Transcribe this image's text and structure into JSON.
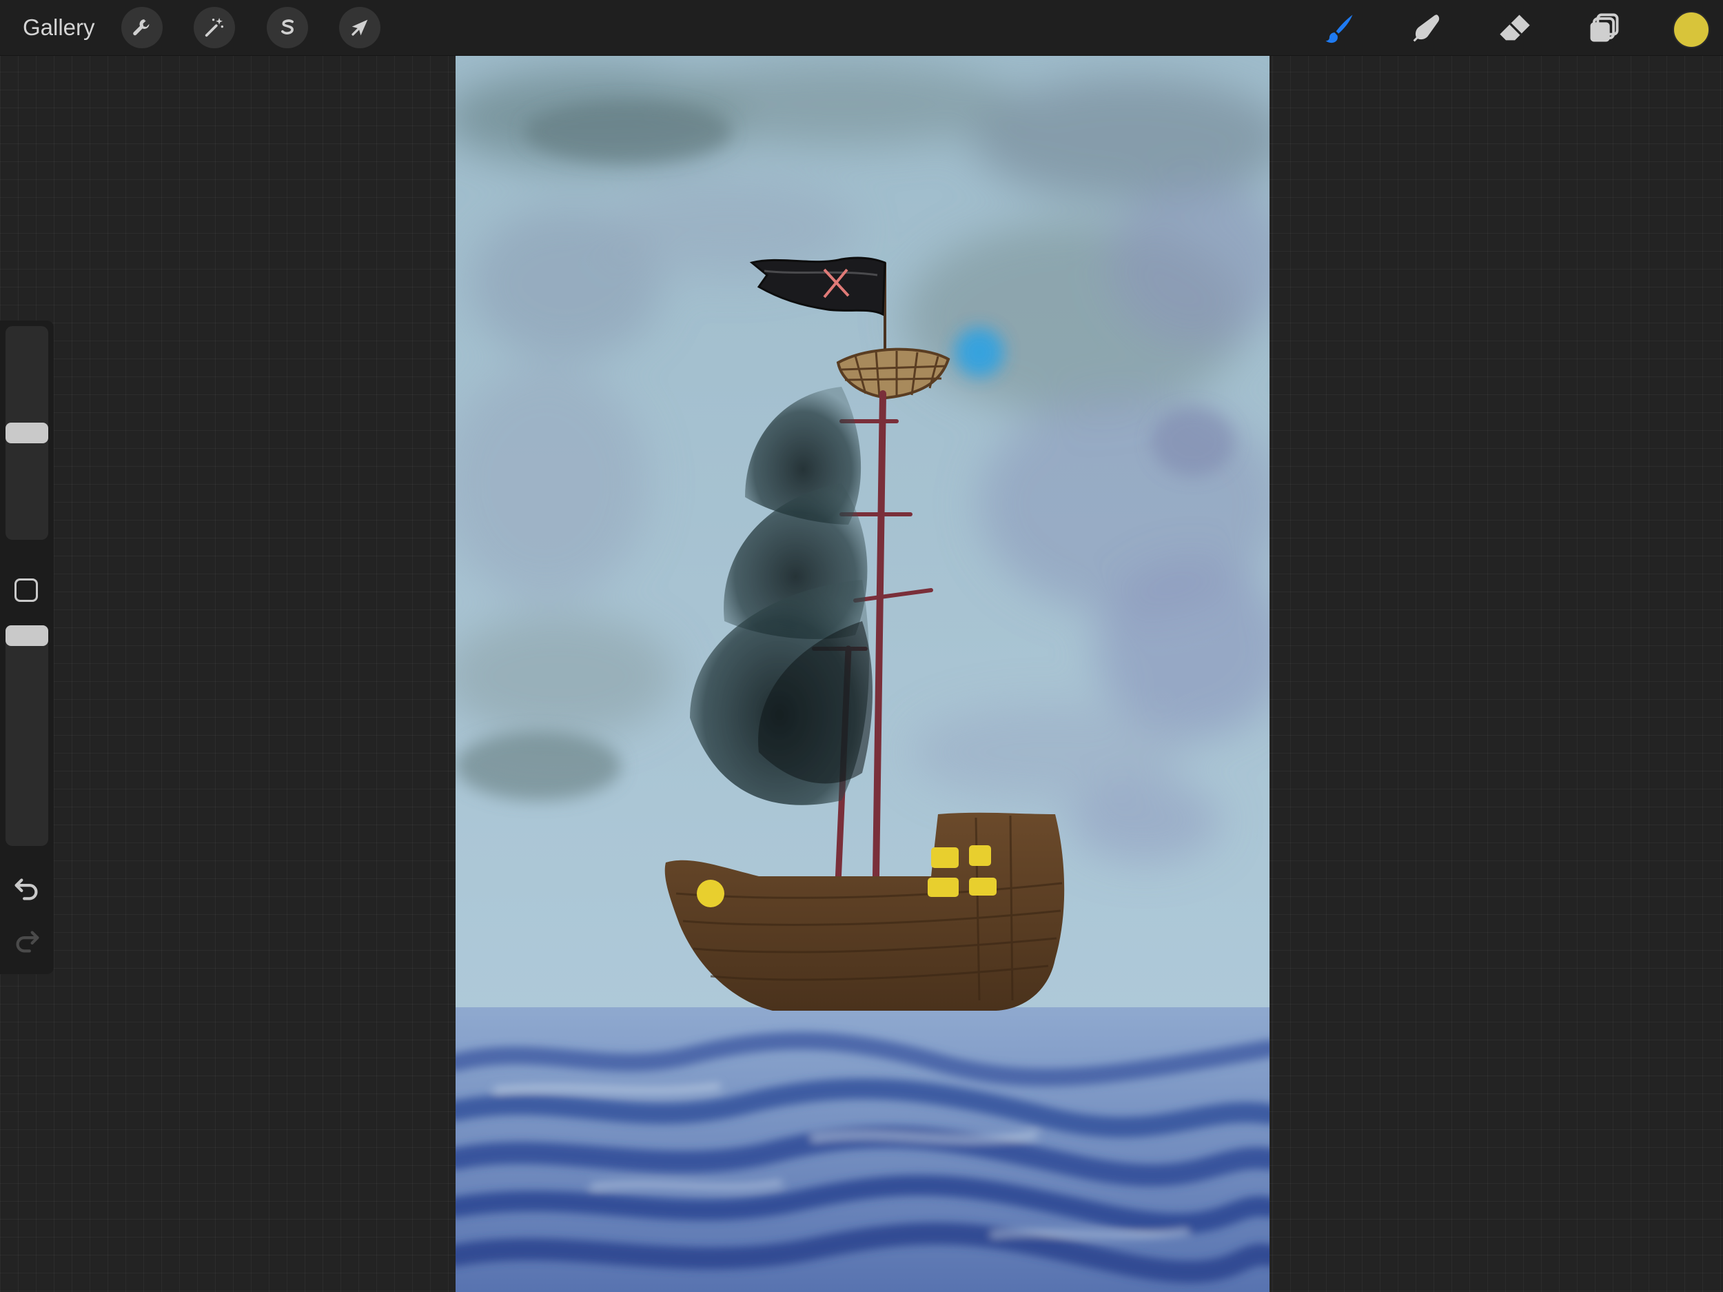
{
  "topbar": {
    "gallery_label": "Gallery",
    "left_tools": [
      {
        "name": "actions",
        "icon": "wrench-icon"
      },
      {
        "name": "adjustments",
        "icon": "magic-wand-icon"
      },
      {
        "name": "selection",
        "icon": "selection-s-icon"
      },
      {
        "name": "transform",
        "icon": "arrow-cursor-icon"
      }
    ],
    "right_tools": [
      {
        "name": "brush",
        "icon": "brush-icon",
        "active": true
      },
      {
        "name": "smudge",
        "icon": "smudge-finger-icon",
        "active": false
      },
      {
        "name": "eraser",
        "icon": "eraser-icon",
        "active": false
      },
      {
        "name": "layers",
        "icon": "layers-icon",
        "active": false
      }
    ],
    "current_color": "#d8c43a",
    "active_tool_color": "#1f7bf2"
  },
  "sidebar": {
    "brush_size_fraction": 0.5,
    "opacity_fraction": 1.0,
    "modify_icon": "square-icon",
    "undo_icon": "undo-icon",
    "redo_icon": "redo-icon"
  },
  "canvas": {
    "artwork": "pirate-ship-painting",
    "sky_color": "#a9c6d6",
    "sea_color": "#2f4f96",
    "hull_color": "#5a3d22",
    "window_color": "#e8cf2e"
  }
}
